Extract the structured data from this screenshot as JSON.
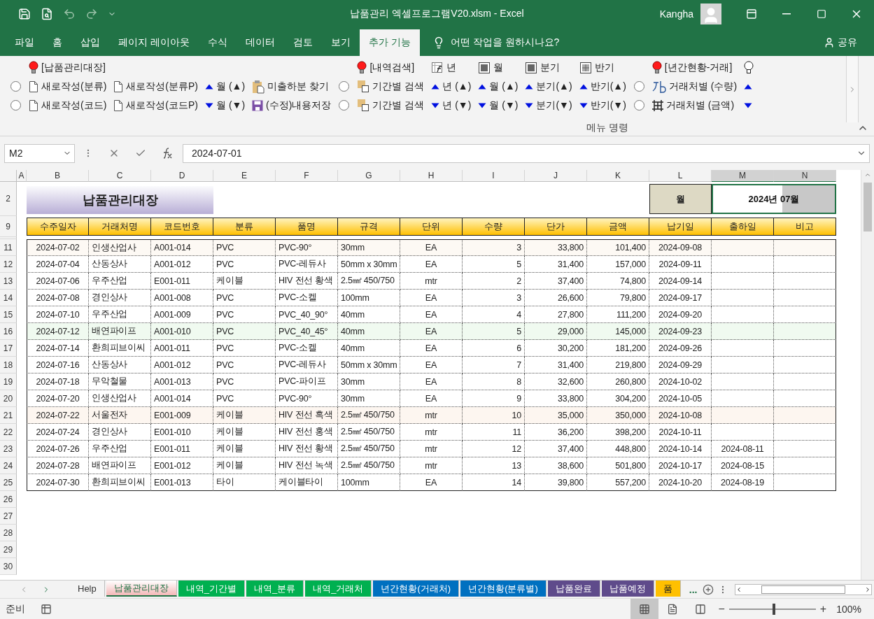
{
  "title_bar": {
    "title": "납품관리 엑셀프로그램V20.xlsm  -  Excel",
    "user": "Kangha"
  },
  "menu": {
    "tabs": [
      {
        "label": "파일",
        "selected": false
      },
      {
        "label": "홈",
        "selected": false
      },
      {
        "label": "삽입",
        "selected": false
      },
      {
        "label": "페이지 레이아웃",
        "selected": false
      },
      {
        "label": "수식",
        "selected": false
      },
      {
        "label": "데이터",
        "selected": false
      },
      {
        "label": "검토",
        "selected": false
      },
      {
        "label": "보기",
        "selected": false
      },
      {
        "label": "추가 기능",
        "selected": true
      }
    ],
    "tell_me": "어떤 작업을 원하시나요?",
    "share": "공유"
  },
  "ribbon": {
    "columns": [
      {
        "items": [
          {
            "kind": "radio",
            "selected": false
          },
          {
            "kind": "radio",
            "selected": false
          }
        ]
      },
      {
        "header": {
          "kind": "bulb",
          "text": "[납품관리대장]"
        },
        "items": [
          {
            "kind": "doc",
            "text": "새로작성(분류)"
          },
          {
            "kind": "doc",
            "text": "새로작성(코드)"
          }
        ]
      },
      {
        "items": [
          {
            "kind": "doc",
            "text": "새로작성(분류P)"
          },
          {
            "kind": "doc",
            "text": "새로작성(코드P)"
          }
        ]
      },
      {
        "items": [
          {
            "kind": "up",
            "text": "월 (▲)"
          },
          {
            "kind": "down",
            "text": "월 (▼)"
          }
        ]
      },
      {
        "items": [
          {
            "kind": "clip",
            "text": "미출하분 찾기"
          },
          {
            "kind": "save",
            "text": "(수정)내용저장"
          }
        ]
      },
      {
        "items": [
          {
            "kind": "radio",
            "selected": false
          },
          {
            "kind": "radio",
            "selected": false
          }
        ]
      },
      {
        "header": {
          "kind": "bulb",
          "text": "[내역검색]"
        },
        "items": [
          {
            "kind": "pages",
            "text": "기간별 검색"
          },
          {
            "kind": "pages",
            "text": "기간별 검색"
          }
        ]
      },
      {
        "header": {
          "kind": "fx",
          "text": "년"
        },
        "items": [
          {
            "kind": "up",
            "text": "년 (▲)"
          },
          {
            "kind": "down",
            "text": "년 (▼)"
          }
        ]
      },
      {
        "header": {
          "kind": "frame",
          "text": "월"
        },
        "items": [
          {
            "kind": "up",
            "text": "월 (▲)"
          },
          {
            "kind": "down",
            "text": "월 (▼)"
          }
        ]
      },
      {
        "header": {
          "kind": "frame",
          "text": "분기"
        },
        "items": [
          {
            "kind": "up",
            "text": "분기(▲)"
          },
          {
            "kind": "down",
            "text": "분기(▼)"
          }
        ]
      },
      {
        "header": {
          "kind": "grid",
          "text": "반기"
        },
        "items": [
          {
            "kind": "up",
            "text": "반기(▲)"
          },
          {
            "kind": "down",
            "text": "반기(▼)"
          }
        ]
      },
      {
        "items": [
          {
            "kind": "radio",
            "selected": false
          },
          {
            "kind": "radio",
            "selected": false
          }
        ]
      },
      {
        "header": {
          "kind": "bulb",
          "text": "[년간현황-거래]"
        },
        "items": [
          {
            "kind": "shape",
            "text": "거래처별 (수량)"
          },
          {
            "kind": "table",
            "text": "거래처별 (금액)"
          }
        ]
      },
      {
        "header": {
          "kind": "bulb_outline"
        },
        "items": [
          {
            "kind": "up"
          },
          {
            "kind": "down"
          }
        ]
      }
    ],
    "group_label": "메뉴 명령"
  },
  "formula_bar": {
    "name_box": "M2",
    "formula": "2024-07-01"
  },
  "sheet": {
    "columns": [
      {
        "label": "A",
        "selected": false
      },
      {
        "label": "B",
        "selected": false
      },
      {
        "label": "C",
        "selected": false
      },
      {
        "label": "D",
        "selected": false
      },
      {
        "label": "E",
        "selected": false
      },
      {
        "label": "F",
        "selected": false
      },
      {
        "label": "G",
        "selected": false
      },
      {
        "label": "H",
        "selected": false
      },
      {
        "label": "I",
        "selected": false
      },
      {
        "label": "J",
        "selected": false
      },
      {
        "label": "K",
        "selected": false
      },
      {
        "label": "L",
        "selected": false
      },
      {
        "label": "M",
        "selected": true
      },
      {
        "label": "N",
        "selected": true
      }
    ],
    "title_row": {
      "row_number": "2",
      "title": "납품관리대장",
      "month_label": "월",
      "month_value": "2024년 07월"
    },
    "header_row": {
      "row_number": "9",
      "labels": [
        "수주일자",
        "거래처명",
        "코드번호",
        "분류",
        "품명",
        "규격",
        "단위",
        "수량",
        "단가",
        "금액",
        "납기일",
        "출하일",
        "비고"
      ]
    },
    "rows": [
      {
        "row_number": "11",
        "color": "#fdf9f4",
        "order_date": "2024-07-02",
        "customer": "인생산업사",
        "code": "A001-014",
        "category": "PVC",
        "item": "PVC-90°",
        "spec": "30mm",
        "unit": "EA",
        "qty": "3",
        "price": "33,800",
        "amount": "101,400",
        "due_date": "2024-09-08"
      },
      {
        "row_number": "12",
        "order_date": "2024-07-04",
        "customer": "산동상사",
        "code": "A001-012",
        "category": "PVC",
        "item": "PVC-레듀사",
        "spec": "50mm x 30mm",
        "unit": "EA",
        "qty": "5",
        "price": "31,400",
        "amount": "157,000",
        "due_date": "2024-09-11"
      },
      {
        "row_number": "13",
        "order_date": "2024-07-06",
        "customer": "우주산업",
        "code": "E001-011",
        "category": "케이블",
        "item": "HIV  전선 황색",
        "spec": "2.5㎟ 450/750",
        "unit": "mtr",
        "qty": "2",
        "price": "37,400",
        "amount": "74,800",
        "due_date": "2024-09-14"
      },
      {
        "row_number": "14",
        "order_date": "2024-07-08",
        "customer": "경인상사",
        "code": "A001-008",
        "category": "PVC",
        "item": "PVC-소켈",
        "spec": "100mm",
        "unit": "EA",
        "qty": "3",
        "price": "26,600",
        "amount": "79,800",
        "due_date": "2024-09-17"
      },
      {
        "row_number": "15",
        "order_date": "2024-07-10",
        "customer": "우주산업",
        "code": "A001-009",
        "category": "PVC",
        "item": "PVC_40_90°",
        "spec": "40mm",
        "unit": "EA",
        "qty": "4",
        "price": "27,800",
        "amount": "111,200",
        "due_date": "2024-09-20"
      },
      {
        "row_number": "16",
        "color": "#f0faf0",
        "order_date": "2024-07-12",
        "customer": "배연파이프",
        "code": "A001-010",
        "category": "PVC",
        "item": "PVC_40_45°",
        "spec": "40mm",
        "unit": "EA",
        "qty": "5",
        "price": "29,000",
        "amount": "145,000",
        "due_date": "2024-09-23"
      },
      {
        "row_number": "17",
        "order_date": "2024-07-14",
        "customer": "환희피브이씨",
        "code": "A001-011",
        "category": "PVC",
        "item": "PVC-소켈",
        "spec": "40mm",
        "unit": "EA",
        "qty": "6",
        "price": "30,200",
        "amount": "181,200",
        "due_date": "2024-09-26"
      },
      {
        "row_number": "18",
        "order_date": "2024-07-16",
        "customer": "산동상사",
        "code": "A001-012",
        "category": "PVC",
        "item": "PVC-레듀사",
        "spec": "50mm x 30mm",
        "unit": "EA",
        "qty": "7",
        "price": "31,400",
        "amount": "219,800",
        "due_date": "2024-09-29"
      },
      {
        "row_number": "19",
        "order_date": "2024-07-18",
        "customer": "무악철물",
        "code": "A001-013",
        "category": "PVC",
        "item": "PVC-파이프",
        "spec": "30mm",
        "unit": "EA",
        "qty": "8",
        "price": "32,600",
        "amount": "260,800",
        "due_date": "2024-10-02"
      },
      {
        "row_number": "20",
        "order_date": "2024-07-20",
        "customer": "인생산업사",
        "code": "A001-014",
        "category": "PVC",
        "item": "PVC-90°",
        "spec": "30mm",
        "unit": "EA",
        "qty": "9",
        "price": "33,800",
        "amount": "304,200",
        "due_date": "2024-10-05"
      },
      {
        "row_number": "21",
        "color": "#fdf6f0",
        "order_date": "2024-07-22",
        "customer": "서울전자",
        "code": "E001-009",
        "category": "케이블",
        "item": "HIV  전선 흑색",
        "spec": "2.5㎟ 450/750",
        "unit": "mtr",
        "qty": "10",
        "price": "35,000",
        "amount": "350,000",
        "due_date": "2024-10-08"
      },
      {
        "row_number": "22",
        "order_date": "2024-07-24",
        "customer": "경인상사",
        "code": "E001-010",
        "category": "케이블",
        "item": "HIV  전선 홍색",
        "spec": "2.5㎟ 450/750",
        "unit": "mtr",
        "qty": "11",
        "price": "36,200",
        "amount": "398,200",
        "due_date": "2024-10-11"
      },
      {
        "row_number": "23",
        "order_date": "2024-07-26",
        "customer": "우주산업",
        "code": "E001-011",
        "category": "케이블",
        "item": "HIV  전선 황색",
        "spec": "2.5㎟ 450/750",
        "unit": "mtr",
        "qty": "12",
        "price": "37,400",
        "amount": "448,800",
        "due_date": "2024-10-14",
        "ship_date": "2024-08-11"
      },
      {
        "row_number": "24",
        "order_date": "2024-07-28",
        "customer": "배연파이프",
        "code": "E001-012",
        "category": "케이블",
        "item": "HIV  전선 녹색",
        "spec": "2.5㎟ 450/750",
        "unit": "mtr",
        "qty": "13",
        "price": "38,600",
        "amount": "501,800",
        "due_date": "2024-10-17",
        "ship_date": "2024-08-15"
      },
      {
        "row_number": "25",
        "order_date": "2024-07-30",
        "customer": "환희피브이씨",
        "code": "E001-013",
        "category": "타이",
        "item": "케이블타이",
        "spec": "100mm",
        "unit": "EA",
        "qty": "14",
        "price": "39,800",
        "amount": "557,200",
        "due_date": "2024-10-20",
        "ship_date": "2024-08-19"
      }
    ],
    "empty_rows": [
      "26",
      "27",
      "28",
      "29",
      "30"
    ]
  },
  "sheet_tabs": {
    "tabs": [
      {
        "label": "Help",
        "selected": false
      },
      {
        "label": "납품관리대장",
        "selected": true,
        "color": "#f4b8b8"
      },
      {
        "label": "내역_기간별",
        "selected": false,
        "color": "#00b050"
      },
      {
        "label": "내역_분류",
        "selected": false,
        "color": "#00b050"
      },
      {
        "label": "내역_거래처",
        "selected": false,
        "color": "#00b050"
      },
      {
        "label": "년간현황(거래처)",
        "selected": false,
        "color": "#0070c0"
      },
      {
        "label": "년간현황(분류별)",
        "selected": false,
        "color": "#0070c0"
      },
      {
        "label": "납품완료",
        "selected": false,
        "color": "#5f4b8b"
      },
      {
        "label": "납품예정",
        "selected": false,
        "color": "#5f4b8b"
      },
      {
        "label": "품",
        "selected": false,
        "color": "#ffc000"
      }
    ],
    "more": "..."
  },
  "status_bar": {
    "status": "준비",
    "zoom_out": "−",
    "zoom_in": "+",
    "zoom": "100%",
    "zoom_slider": {
      "level": 0.5
    }
  }
}
